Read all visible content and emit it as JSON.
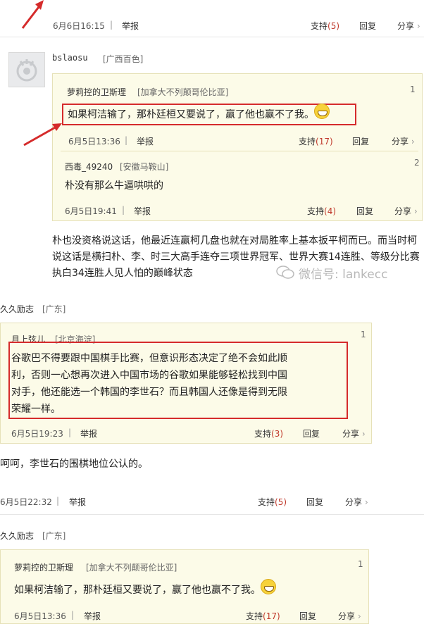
{
  "c1_footer": {
    "time": "6月6日16:15",
    "sep": "|",
    "report": "举报",
    "support": "支持",
    "support_count": "(5)",
    "reply": "回复",
    "share": "分享"
  },
  "c2": {
    "user": "bslaosu",
    "loc": "[广西百色]",
    "q1": {
      "user": "萝莉控的卫斯理",
      "loc": "[加拿大不列颠哥伦比亚]",
      "floor": "1",
      "text": "如果柯洁输了，那朴廷桓又要说了，赢了他也赢不了我。",
      "time": "6月5日13:36",
      "sep": "|",
      "report": "举报",
      "support": "支持",
      "support_count": "(17)",
      "reply": "回复",
      "share": "分享"
    },
    "q2": {
      "user": "西毒_49240",
      "loc": "[安徽马鞍山]",
      "floor": "2",
      "text": "朴没有那么牛逼哄哄的",
      "time": "6月5日19:41",
      "sep": "|",
      "report": "举报",
      "support": "支持",
      "support_count": "(4)",
      "reply": "回复",
      "share": "分享"
    },
    "body1": "朴也没资格说这话，他最近连赢柯几盘也就在对局胜率上基本扳平柯而已。而当时柯",
    "body2": "说这话是横扫朴、李、时三大高手连夺三项世界冠军、世界大赛14连胜、等级分比赛",
    "body3": "执白34连胜人见人怕的巅峰状态",
    "watermark": "微信号: lankecc"
  },
  "c3": {
    "user": "久久励志",
    "loc": "[广东]",
    "q1": {
      "user": "月上弦儿",
      "loc": "[北京海淀]",
      "floor": "1",
      "l1": "谷歌巴不得要跟中国棋手比赛，但意识形态决定了绝不会如此顺",
      "l2": "利，否则一心想再次进入中国市场的谷歌如果能够轻松找到中国",
      "l3": "对手，他还能选一个韩国的李世石？而且韩国人还像是得到无限",
      "l4": "荣耀一样。",
      "time": "6月5日19:23",
      "sep": "|",
      "report": "举报",
      "support": "支持",
      "support_count": "(3)",
      "reply": "回复",
      "share": "分享"
    },
    "body": "呵呵，李世石的围棋地位公认的。",
    "footer": {
      "time": "6月5日22:32",
      "sep": "|",
      "report": "举报",
      "support": "支持",
      "support_count": "(5)",
      "reply": "回复",
      "share": "分享"
    }
  },
  "c4": {
    "user": "久久励志",
    "loc": "[广东]",
    "q1": {
      "user": "萝莉控的卫斯理",
      "loc": "[加拿大不列颠哥伦比亚]",
      "floor": "1",
      "text": "如果柯洁输了，那朴廷桓又要说了，赢了他也赢不了我。",
      "time": "6月5日13:36",
      "sep": "|",
      "report": "举报",
      "support": "支持",
      "support_count": "(17)",
      "reply": "回复",
      "share": "分享"
    }
  },
  "colors": {
    "annotation_red": "#d52b2b",
    "quote_bg": "#fcfbe8"
  }
}
